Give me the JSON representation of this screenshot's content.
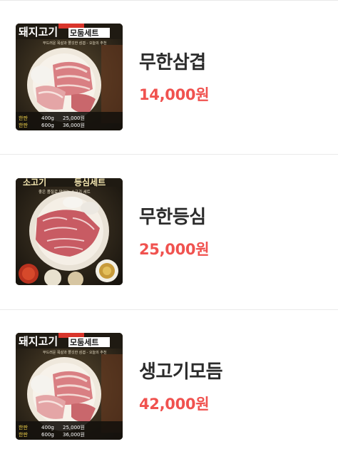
{
  "menu": {
    "items": [
      {
        "name": "무한삼겹",
        "price": "14,000원",
        "photo": {
          "title_main": "돼지고기",
          "title_sub": "모둠세트",
          "caption": "부드러운 목살과 쫄깃한 삼겹 - 오늘의 추천",
          "prices": [
            {
              "label": "한판",
              "weight": "400g",
              "price": "25,000원"
            },
            {
              "label": "한판",
              "weight": "600g",
              "price": "36,000원"
            }
          ]
        }
      },
      {
        "name": "무한등심",
        "price": "25,000원",
        "photo": {
          "title_main": "소고기",
          "title_sub": "등심세트",
          "caption": "좋은 품질로 맛있는 소고기 세트"
        }
      },
      {
        "name": "생고기모듬",
        "price": "42,000원",
        "photo": {
          "title_main": "돼지고기",
          "title_sub": "모둠세트",
          "caption": "부드러운 목살과 쫄깃한 삼겹 - 오늘의 추천",
          "prices": [
            {
              "label": "한판",
              "weight": "400g",
              "price": "25,000원"
            },
            {
              "label": "한판",
              "weight": "600g",
              "price": "36,000원"
            }
          ]
        }
      }
    ]
  },
  "colors": {
    "price": "#f0524f",
    "name": "#2b2b2b",
    "divider": "#e9e9e9"
  }
}
